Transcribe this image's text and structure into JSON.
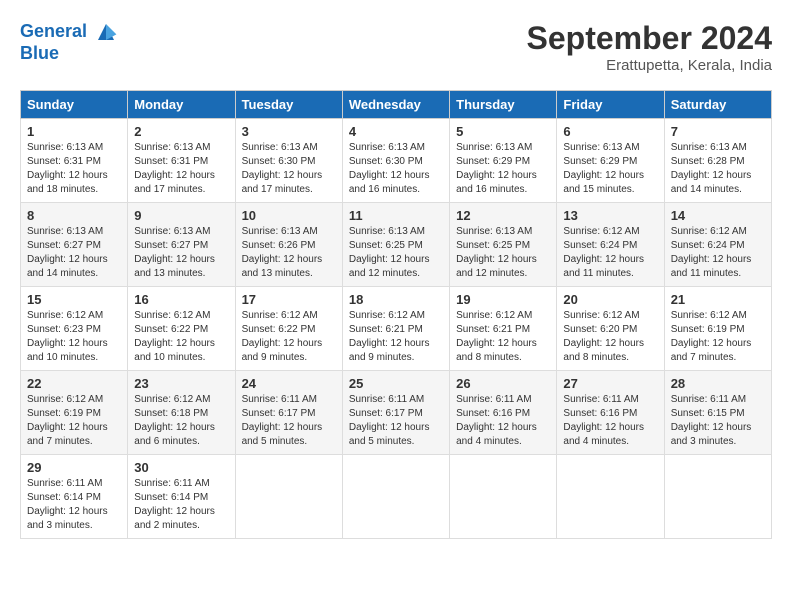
{
  "logo": {
    "line1": "General",
    "line2": "Blue"
  },
  "title": "September 2024",
  "subtitle": "Erattupetta, Kerala, India",
  "weekdays": [
    "Sunday",
    "Monday",
    "Tuesday",
    "Wednesday",
    "Thursday",
    "Friday",
    "Saturday"
  ],
  "weeks": [
    [
      {
        "day": "1",
        "sunrise": "6:13 AM",
        "sunset": "6:31 PM",
        "daylight": "12 hours and 18 minutes."
      },
      {
        "day": "2",
        "sunrise": "6:13 AM",
        "sunset": "6:31 PM",
        "daylight": "12 hours and 17 minutes."
      },
      {
        "day": "3",
        "sunrise": "6:13 AM",
        "sunset": "6:30 PM",
        "daylight": "12 hours and 17 minutes."
      },
      {
        "day": "4",
        "sunrise": "6:13 AM",
        "sunset": "6:30 PM",
        "daylight": "12 hours and 16 minutes."
      },
      {
        "day": "5",
        "sunrise": "6:13 AM",
        "sunset": "6:29 PM",
        "daylight": "12 hours and 16 minutes."
      },
      {
        "day": "6",
        "sunrise": "6:13 AM",
        "sunset": "6:29 PM",
        "daylight": "12 hours and 15 minutes."
      },
      {
        "day": "7",
        "sunrise": "6:13 AM",
        "sunset": "6:28 PM",
        "daylight": "12 hours and 14 minutes."
      }
    ],
    [
      {
        "day": "8",
        "sunrise": "6:13 AM",
        "sunset": "6:27 PM",
        "daylight": "12 hours and 14 minutes."
      },
      {
        "day": "9",
        "sunrise": "6:13 AM",
        "sunset": "6:27 PM",
        "daylight": "12 hours and 13 minutes."
      },
      {
        "day": "10",
        "sunrise": "6:13 AM",
        "sunset": "6:26 PM",
        "daylight": "12 hours and 13 minutes."
      },
      {
        "day": "11",
        "sunrise": "6:13 AM",
        "sunset": "6:25 PM",
        "daylight": "12 hours and 12 minutes."
      },
      {
        "day": "12",
        "sunrise": "6:13 AM",
        "sunset": "6:25 PM",
        "daylight": "12 hours and 12 minutes."
      },
      {
        "day": "13",
        "sunrise": "6:12 AM",
        "sunset": "6:24 PM",
        "daylight": "12 hours and 11 minutes."
      },
      {
        "day": "14",
        "sunrise": "6:12 AM",
        "sunset": "6:24 PM",
        "daylight": "12 hours and 11 minutes."
      }
    ],
    [
      {
        "day": "15",
        "sunrise": "6:12 AM",
        "sunset": "6:23 PM",
        "daylight": "12 hours and 10 minutes."
      },
      {
        "day": "16",
        "sunrise": "6:12 AM",
        "sunset": "6:22 PM",
        "daylight": "12 hours and 10 minutes."
      },
      {
        "day": "17",
        "sunrise": "6:12 AM",
        "sunset": "6:22 PM",
        "daylight": "12 hours and 9 minutes."
      },
      {
        "day": "18",
        "sunrise": "6:12 AM",
        "sunset": "6:21 PM",
        "daylight": "12 hours and 9 minutes."
      },
      {
        "day": "19",
        "sunrise": "6:12 AM",
        "sunset": "6:21 PM",
        "daylight": "12 hours and 8 minutes."
      },
      {
        "day": "20",
        "sunrise": "6:12 AM",
        "sunset": "6:20 PM",
        "daylight": "12 hours and 8 minutes."
      },
      {
        "day": "21",
        "sunrise": "6:12 AM",
        "sunset": "6:19 PM",
        "daylight": "12 hours and 7 minutes."
      }
    ],
    [
      {
        "day": "22",
        "sunrise": "6:12 AM",
        "sunset": "6:19 PM",
        "daylight": "12 hours and 7 minutes."
      },
      {
        "day": "23",
        "sunrise": "6:12 AM",
        "sunset": "6:18 PM",
        "daylight": "12 hours and 6 minutes."
      },
      {
        "day": "24",
        "sunrise": "6:11 AM",
        "sunset": "6:17 PM",
        "daylight": "12 hours and 5 minutes."
      },
      {
        "day": "25",
        "sunrise": "6:11 AM",
        "sunset": "6:17 PM",
        "daylight": "12 hours and 5 minutes."
      },
      {
        "day": "26",
        "sunrise": "6:11 AM",
        "sunset": "6:16 PM",
        "daylight": "12 hours and 4 minutes."
      },
      {
        "day": "27",
        "sunrise": "6:11 AM",
        "sunset": "6:16 PM",
        "daylight": "12 hours and 4 minutes."
      },
      {
        "day": "28",
        "sunrise": "6:11 AM",
        "sunset": "6:15 PM",
        "daylight": "12 hours and 3 minutes."
      }
    ],
    [
      {
        "day": "29",
        "sunrise": "6:11 AM",
        "sunset": "6:14 PM",
        "daylight": "12 hours and 3 minutes."
      },
      {
        "day": "30",
        "sunrise": "6:11 AM",
        "sunset": "6:14 PM",
        "daylight": "12 hours and 2 minutes."
      },
      null,
      null,
      null,
      null,
      null
    ]
  ],
  "labels": {
    "sunrise": "Sunrise:",
    "sunset": "Sunset:",
    "daylight": "Daylight:"
  }
}
